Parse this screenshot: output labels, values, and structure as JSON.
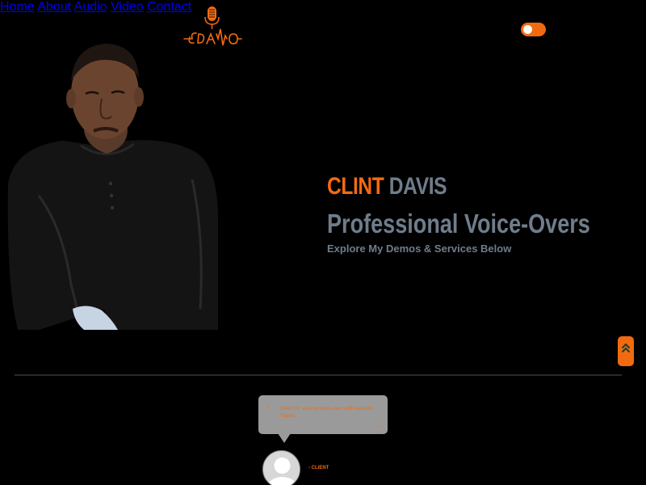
{
  "header": {
    "logo_text": "CDAVO",
    "nav": [
      {
        "label": "Home"
      },
      {
        "label": "About"
      },
      {
        "label": "Audio"
      },
      {
        "label": "Video"
      },
      {
        "label": "Contact"
      }
    ],
    "theme_toggle": {
      "on": true
    }
  },
  "hero": {
    "first_name": "CLINT",
    "last_name": "DAVIS",
    "title": "Professional Voice-Overs",
    "subtitle": "Explore My Demos & Services Below"
  },
  "testimonial": {
    "quote_open": "““",
    "quote": "Great VO, easy process even with revisions. Thanks",
    "quote_close": "””",
    "client": "- CLIENT"
  },
  "colors": {
    "accent": "#f26a10",
    "muted_text": "#6f7d8b",
    "background": "#000000"
  },
  "icons": {
    "logo": "microphone-logo",
    "scroll_top": "double-chevron-up-icon",
    "avatar": "user-silhouette-icon"
  }
}
